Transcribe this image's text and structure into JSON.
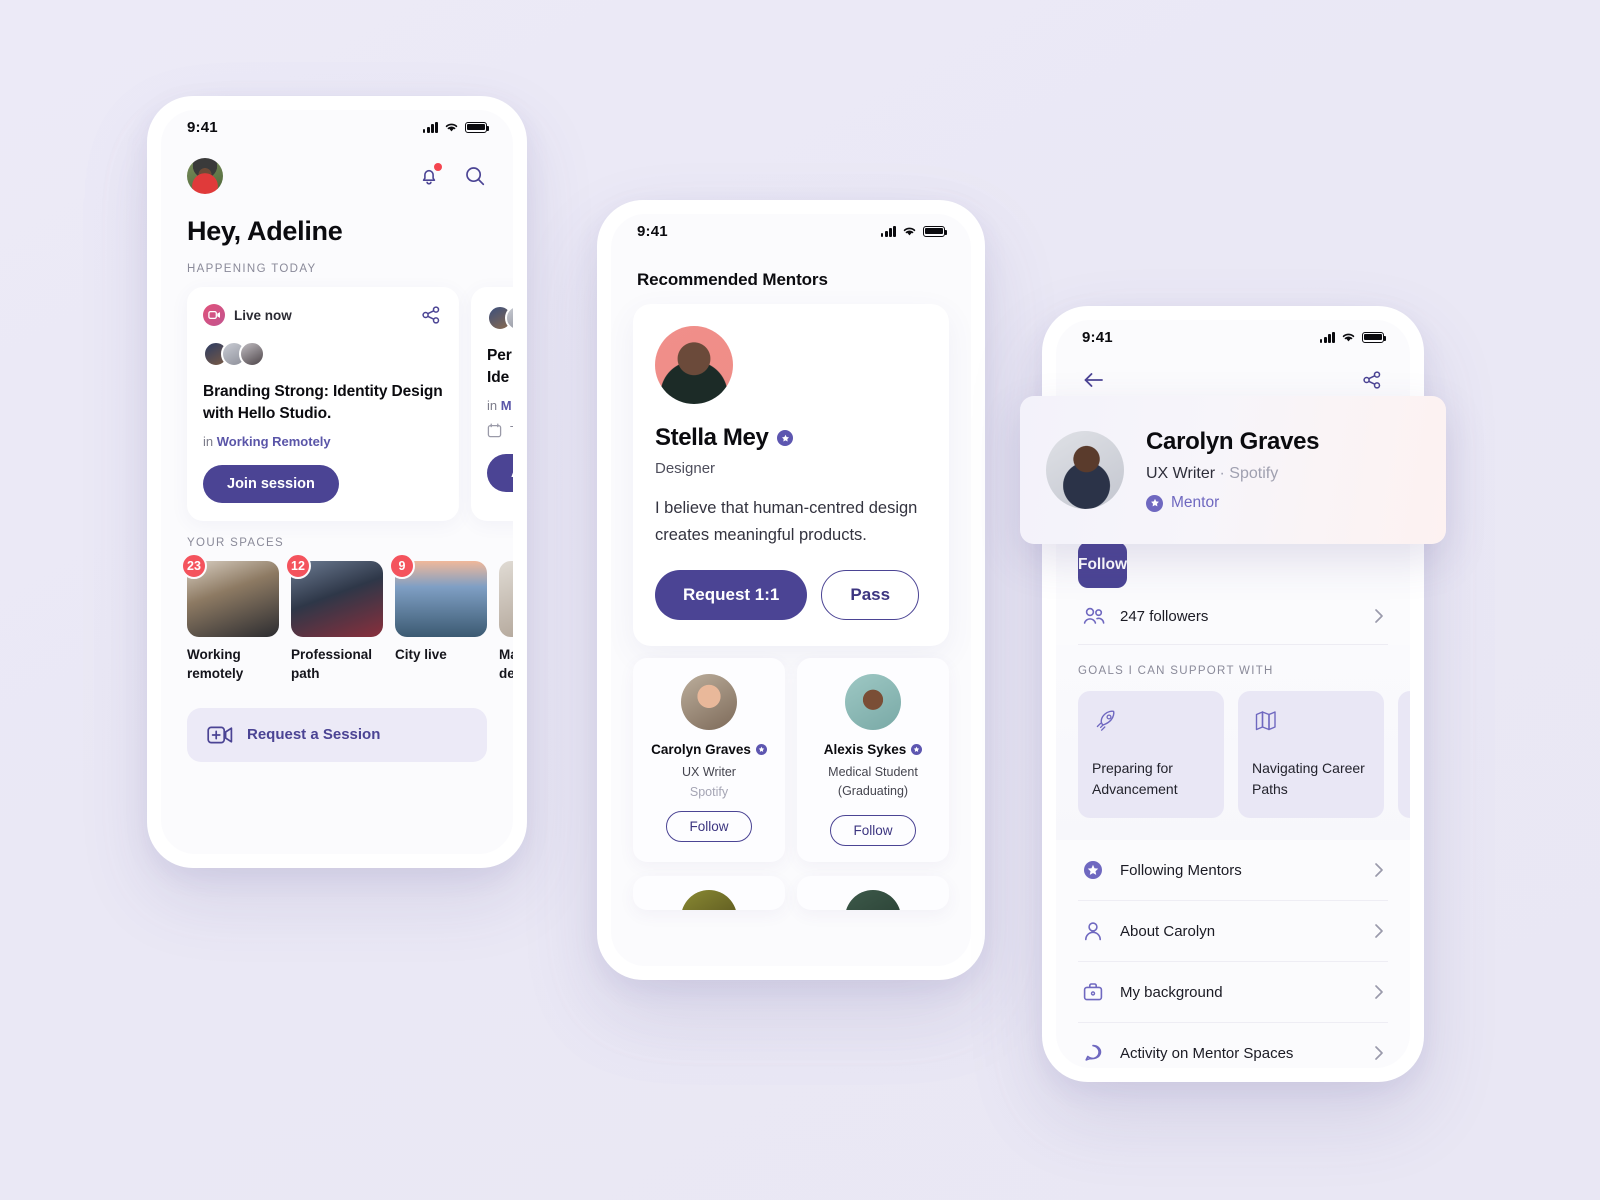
{
  "phone1": {
    "status": {
      "time": "9:41"
    },
    "topbar": {
      "avatar_name": "adeline-avatar",
      "bell": "notification-bell",
      "search": "search"
    },
    "greeting": "Hey, Adeline",
    "section_label": "HAPPENING TODAY",
    "cards": [
      {
        "live_label": "Live now",
        "title": "Branding Strong: Identity Design with Hello Studio.",
        "in_prefix": "in",
        "space": "Working Remotely",
        "cta": "Join session"
      },
      {
        "title_partial_1": "Per",
        "title_partial_2": "Ide",
        "in_prefix": "in",
        "space_partial": "M",
        "date_partial": "T",
        "cta_partial": "A"
      }
    ],
    "spaces_label": "YOUR SPACES",
    "spaces": [
      {
        "badge": "23",
        "name": "Working remotely"
      },
      {
        "badge": "12",
        "name": "Professional path"
      },
      {
        "badge": "9",
        "name": "City live"
      },
      {
        "badge": "",
        "name": "Ma dec"
      }
    ],
    "request_session": "Request a Session"
  },
  "phone2": {
    "status": {
      "time": "9:41"
    },
    "title": "Recommended Mentors",
    "featured": {
      "name": "Stella Mey",
      "verified": true,
      "role": "Designer",
      "quote": "I believe that human-centred design creates meaningful products.",
      "primary_cta": "Request 1:1",
      "secondary_cta": "Pass"
    },
    "mini_mentors": [
      {
        "name": "Carolyn Graves",
        "verified": true,
        "role": "UX Writer",
        "org": "Spotify",
        "cta": "Follow"
      },
      {
        "name": "Alexis Sykes",
        "verified": true,
        "role": "Medical Student (Graduating)",
        "org": "",
        "cta": "Follow"
      }
    ]
  },
  "phone3": {
    "status": {
      "time": "9:41"
    },
    "nav": {
      "back": "back-arrow",
      "share": "share"
    },
    "profile": {
      "name": "Carolyn Graves",
      "role": "UX Writer",
      "separator": "·",
      "org": "Spotify",
      "badge": "Mentor"
    },
    "follow_cta": "Follow",
    "followers": "247 followers",
    "goals_label": "GOALS I CAN SUPPORT WITH",
    "goals": [
      {
        "icon": "rocket-icon",
        "text": "Preparing for Advancement"
      },
      {
        "icon": "map-icon",
        "text": "Navigating Career Paths"
      },
      {
        "icon": "partial-icon",
        "text": ""
      }
    ],
    "menu": [
      {
        "icon": "star-badge-icon",
        "label": "Following Mentors"
      },
      {
        "icon": "person-icon",
        "label": "About Carolyn"
      },
      {
        "icon": "briefcase-icon",
        "label": "My background"
      },
      {
        "icon": "chat-icon",
        "label": "Activity on Mentor Spaces"
      }
    ]
  },
  "colors": {
    "accent": "#4b4494",
    "accent_light": "#6f68c0",
    "background": "#eae8f5",
    "danger": "#f4535d",
    "muted": "#8a8a99"
  }
}
